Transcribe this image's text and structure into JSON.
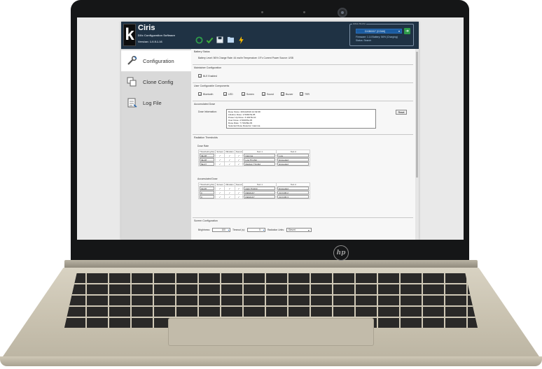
{
  "app": {
    "brand_letter": "k",
    "name": "Ciris",
    "subtitle": "DXx Configuration Software",
    "version": "Version: 1.0.5.1.16"
  },
  "toolbar": {
    "icons": [
      "refresh-icon",
      "check-icon",
      "save-icon",
      "folder-icon",
      "flash-icon"
    ]
  },
  "active_device": {
    "legend": "Active Device",
    "selected": "DXIB0007 [COM6]",
    "info": "Firmware: 1.14    Battery: 56% (Charging)",
    "status": "Status: Search"
  },
  "sidebar": {
    "items": [
      {
        "label": "Configuration",
        "icon": "wrench-icon"
      },
      {
        "label": "Clone Config",
        "icon": "clone-icon"
      },
      {
        "label": "Log File",
        "icon": "log-file-icon"
      }
    ]
  },
  "battery_status": {
    "title": "Battery Status",
    "text": "Battery Level: 56%   Charge Rate: 44 ma/hr   Temperature: 19°c   Current Power Source: USB"
  },
  "maintainer": {
    "title": "Maintainer Configuration",
    "ble_label": "BLE Enabled"
  },
  "components": {
    "title": "User Configurable Components",
    "items": [
      "Bluetooth",
      "LED",
      "Screen",
      "Sound",
      "Buzzer",
      "TRR"
    ]
  },
  "accumulated_dose": {
    "title": "Accumulated Dose",
    "label": "Dose Information:",
    "lines": [
      "Dose Since: 20/11/2019 14:32:08",
      "Lifetime Dose: 2.53307E-05",
      "Power Up Dose: 3.4197E-10",
      "User Dose: 2.53307E-05",
      "Dose Rate: 7.71623E-09",
      "Selected Dose Detector: Gamma"
    ],
    "reset_label": "Reset"
  },
  "radiation_thresholds": {
    "title": "Radiation Thresholds",
    "headers": [
      "Threshold (µSv)",
      "Screen",
      "Vibration",
      "Sound",
      "Text 1",
      "Text 2"
    ],
    "dose_rate": {
      "title": "Dose Rate",
      "rows": [
        [
          "3E-08",
          "Gamma",
          "Low"
        ],
        [
          "3E-08",
          "Low Thrshld",
          "Exceeded"
        ],
        [
          "5E-07",
          "Medium Thrshld",
          "Exceeded"
        ]
      ]
    },
    "accumulated": {
      "title": "Accumulated Dose",
      "rows": [
        [
          "1E-06",
          "High Thrshld",
          "Exceeded"
        ],
        [
          "0",
          "DEFAULT",
          "ACCUM 2"
        ],
        [
          "0",
          "DEFAULT",
          "ACCUM 3"
        ]
      ]
    }
  },
  "screen_config": {
    "title": "Screen Configuration",
    "brightness_label": "Brightness:",
    "brightness_value": "100",
    "timeout_label": "Timeout (s):",
    "timeout_value": "5",
    "units_label": "Radiation Units:",
    "units_value": "Sievert"
  },
  "hardware": {
    "laptop_logo": "hp"
  }
}
